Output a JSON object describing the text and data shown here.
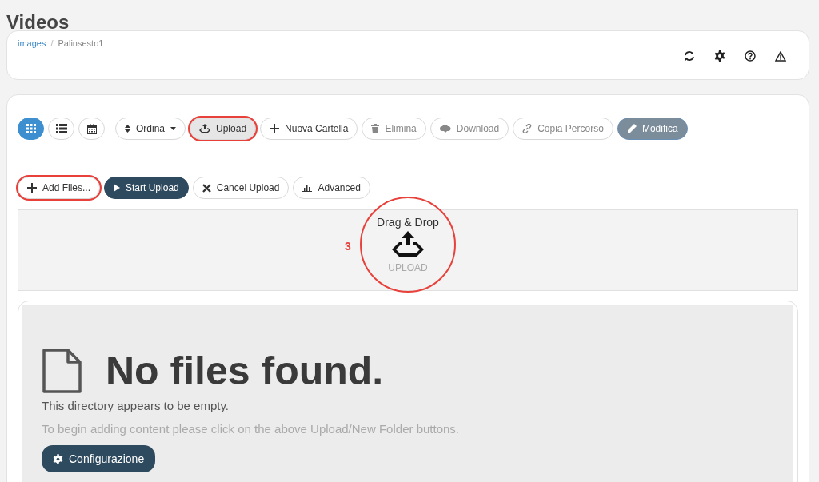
{
  "page_title": "Videos",
  "breadcrumb_separator": "/",
  "breadcrumb": [
    {
      "label": "images",
      "link": true
    },
    {
      "label": "Palinsesto1",
      "link": false
    }
  ],
  "view_toggles": [
    {
      "selected": true
    },
    {
      "selected": false
    },
    {
      "selected": false
    }
  ],
  "toolbar": [
    {
      "label": "Ordina",
      "caret": true,
      "disabled": false,
      "kind": "default",
      "highlighted": false
    },
    {
      "label": "Upload",
      "caret": false,
      "disabled": false,
      "kind": "pressed",
      "highlighted": true
    },
    {
      "label": "Nuova Cartella",
      "caret": false,
      "disabled": false,
      "kind": "default",
      "highlighted": false
    },
    {
      "label": "Elimina",
      "caret": false,
      "disabled": true,
      "kind": "default",
      "highlighted": false
    },
    {
      "label": "Download",
      "caret": false,
      "disabled": true,
      "kind": "default",
      "highlighted": false
    },
    {
      "label": "Copia Percorso",
      "caret": false,
      "disabled": true,
      "kind": "default",
      "highlighted": false
    },
    {
      "label": "Modifica",
      "caret": false,
      "disabled": false,
      "kind": "primary",
      "highlighted": false
    }
  ],
  "upload_buttons": [
    {
      "label": "Add Files...",
      "kind": "default",
      "highlighted": true
    },
    {
      "label": "Start Upload",
      "kind": "dark",
      "highlighted": false
    },
    {
      "label": "Cancel Upload",
      "kind": "default",
      "highlighted": false
    },
    {
      "label": "Advanced",
      "kind": "default",
      "highlighted": false
    }
  ],
  "dropzone": {
    "title": "Drag & Drop",
    "caption": "UPLOAD",
    "annotation": "3",
    "highlighted": true
  },
  "empty_state": {
    "heading": "No files found.",
    "message": "This directory appears to be empty.",
    "hint": "To begin adding content please click on the above Upload/New Folder buttons.",
    "button": "Configurazione"
  }
}
